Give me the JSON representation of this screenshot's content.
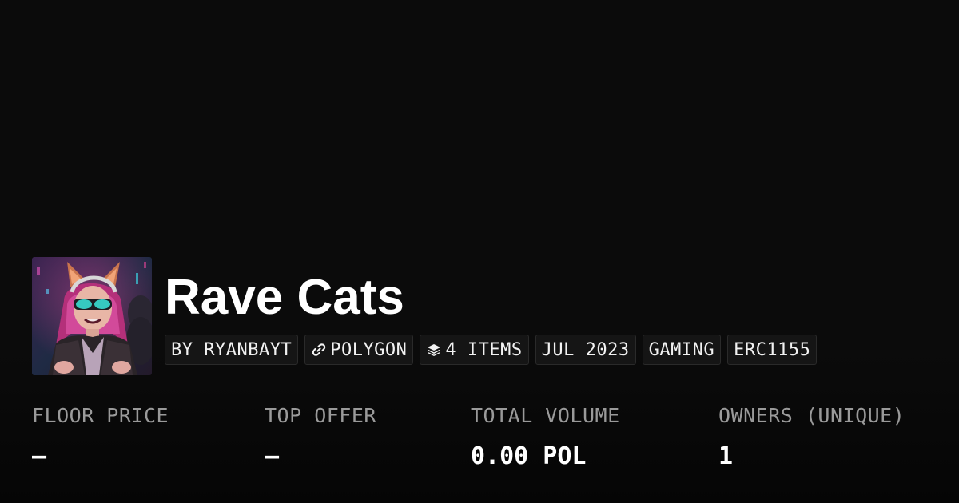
{
  "collection": {
    "name": "Rave Cats",
    "avatar_icon": "cyberpunk-cat-girl-avatar"
  },
  "tags": [
    {
      "label": "BY RYANBAYT",
      "icon": null
    },
    {
      "label": "POLYGON",
      "icon": "link-icon"
    },
    {
      "label": "4 ITEMS",
      "icon": "layers-icon"
    },
    {
      "label": "JUL 2023",
      "icon": null
    },
    {
      "label": "GAMING",
      "icon": null
    },
    {
      "label": "ERC1155",
      "icon": null
    }
  ],
  "stats": {
    "floor_price": {
      "label": "FLOOR PRICE",
      "value": "–"
    },
    "top_offer": {
      "label": "TOP OFFER",
      "value": "–"
    },
    "total_volume": {
      "label": "TOTAL VOLUME",
      "value": "0.00 POL"
    },
    "owners": {
      "label": "OWNERS (UNIQUE)",
      "value": "1"
    }
  },
  "colors": {
    "background": "#0b0b0b",
    "tag_background": "#151515",
    "label_gray": "#9a9a9a",
    "text_white": "#ffffff"
  }
}
